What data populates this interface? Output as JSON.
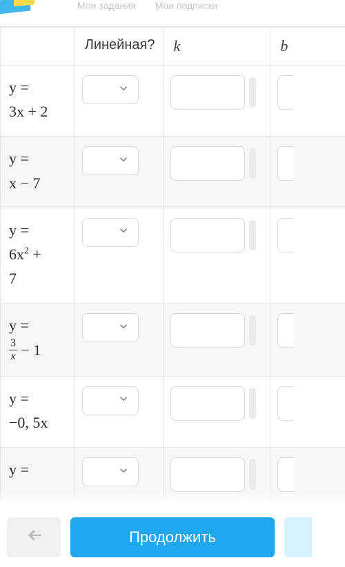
{
  "nav": {
    "item1": "Мои задания",
    "item2": "Мои подписки"
  },
  "headers": {
    "linear": "Линейная?",
    "k": "k",
    "b": "b"
  },
  "rows": [
    {
      "eq_line1": "y =",
      "eq_line2": "3x + 2"
    },
    {
      "eq_line1": "y =",
      "eq_line2": "x − 7"
    },
    {
      "eq_line1": "y =",
      "eq_line2_pre": "6x",
      "eq_line2_sup": "2",
      "eq_line2_post": " +",
      "eq_line3": "7"
    },
    {
      "eq_line1": "y =",
      "frac_num": "3",
      "frac_den": "x",
      "eq_line2_post": " − 1"
    },
    {
      "eq_line1": "y =",
      "eq_line2": "−0, 5x"
    },
    {
      "eq_line1": "y ="
    }
  ],
  "buttons": {
    "continue": "Продолжить"
  }
}
